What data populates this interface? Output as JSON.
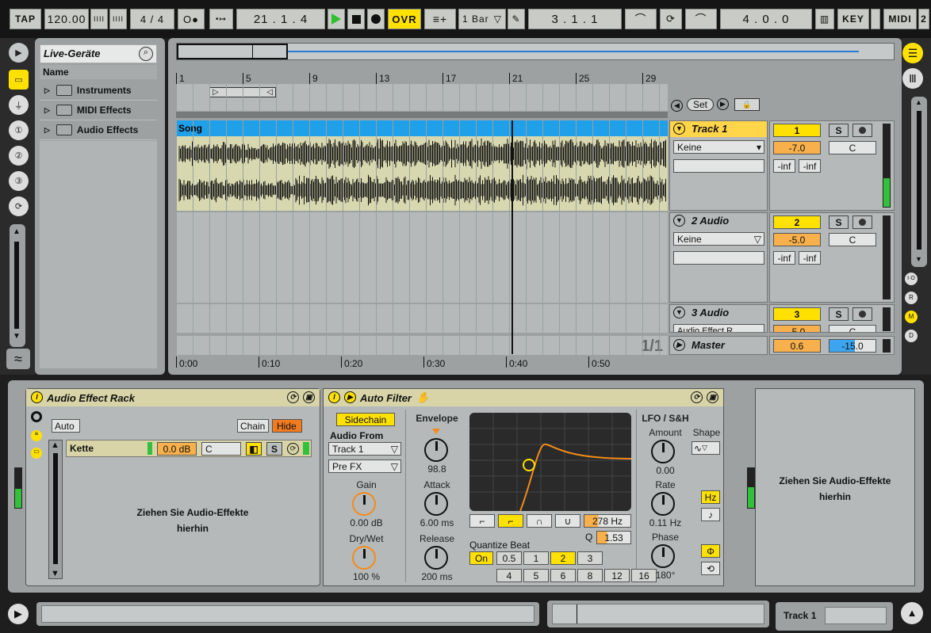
{
  "transport": {
    "tap": "TAP",
    "tempo": "120.00",
    "nudge1": "IIII",
    "nudge2": "IIII",
    "signature": "4 / 4",
    "metronome": "O●",
    "follow": "•↦",
    "position": "21 .  1 .  4",
    "ovr": "OVR",
    "quantize": "1 Bar",
    "loop_start": "3 .  1 .  1",
    "loop_length": "4 .  0 .  0",
    "key": "KEY",
    "midi": "MIDI",
    "extra": "2"
  },
  "browser": {
    "title": "Live-Geräte",
    "column": "Name",
    "items": [
      "Instruments",
      "MIDI Effects",
      "Audio Effects"
    ]
  },
  "arrangement": {
    "bars": [
      "1",
      "5",
      "9",
      "13",
      "17",
      "21",
      "25",
      "29"
    ],
    "times": [
      "0:00",
      "0:10",
      "0:20",
      "0:30",
      "0:40",
      "0:50"
    ],
    "set_label": "Set",
    "clip_name": "Song",
    "page": "1/1",
    "colors": {
      "clip": "#1fa0e8",
      "wave_bg": "#d8d8b0",
      "track_sel": "#ffd54a",
      "yellow": "#ffe100",
      "orange": "#f7b04b",
      "blue": "#3da5f0"
    },
    "tracks": [
      {
        "name": "Track 1",
        "input": "Keine",
        "number": "1",
        "solo": "S",
        "volume": "-7.0",
        "pan": "C",
        "peak_l": "-inf",
        "peak_r": "-inf"
      },
      {
        "name": "2 Audio",
        "input": "Keine",
        "number": "2",
        "solo": "S",
        "volume": "-5.0",
        "pan": "C",
        "peak_l": "-inf",
        "peak_r": "-inf"
      },
      {
        "name": "3 Audio",
        "input": "Audio Effect R",
        "number": "3",
        "solo": "S",
        "volume": "-5.0",
        "pan": "C"
      }
    ],
    "master": {
      "name": "Master",
      "volume": "0.6",
      "pan": "-15.0"
    }
  },
  "rack": {
    "title": "Audio Effect Rack",
    "auto": "Auto",
    "chain": "Chain",
    "hide": "Hide",
    "chain_name": "Kette",
    "chain_vol": "0.0 dB",
    "chain_pan": "C",
    "solo": "S",
    "drop_text": "Ziehen Sie Audio-Effekte hierhin"
  },
  "autofilter": {
    "title": "Auto Filter",
    "sidechain": "Sidechain",
    "audio_from": "Audio From",
    "source": "Track 1",
    "tap": "Pre FX",
    "gain_label": "Gain",
    "gain": "0.00 dB",
    "drywet_label": "Dry/Wet",
    "drywet": "100 %",
    "envelope_label": "Envelope",
    "envelope": "98.8",
    "attack_label": "Attack",
    "attack": "6.00 ms",
    "release_label": "Release",
    "release": "200 ms",
    "freq": "278 Hz",
    "q_label": "Q",
    "q": "1.53",
    "quantize_label": "Quantize Beat",
    "quantize_on": "On",
    "quantize_values": [
      "0.5",
      "1",
      "2",
      "3",
      "4",
      "5",
      "6",
      "8",
      "12",
      "16"
    ],
    "quantize_selected": "2",
    "lfo_label": "LFO / S&H",
    "amount_label": "Amount",
    "amount": "0.00",
    "shape_label": "Shape",
    "rate_label": "Rate",
    "rate": "0.11 Hz",
    "hz": "Hz",
    "phase_label": "Phase",
    "phase": "180°"
  },
  "dropzone": {
    "text": "Ziehen Sie Audio-Effekte hierhin"
  },
  "statusbar": {
    "track_label": "Track 1"
  }
}
